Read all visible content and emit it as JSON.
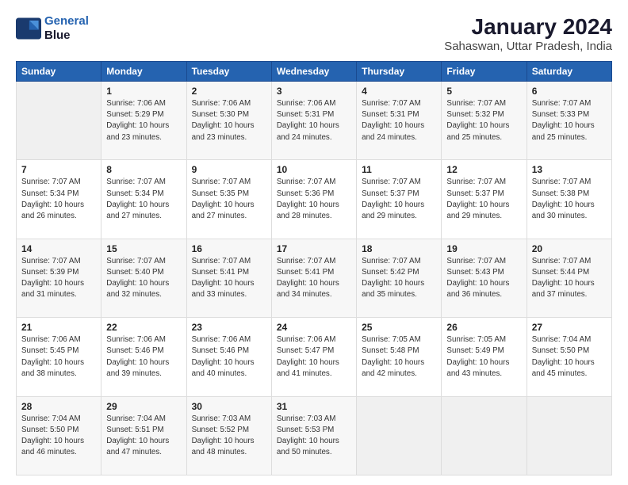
{
  "logo": {
    "line1": "General",
    "line2": "Blue"
  },
  "title": "January 2024",
  "subtitle": "Sahaswan, Uttar Pradesh, India",
  "weekdays": [
    "Sunday",
    "Monday",
    "Tuesday",
    "Wednesday",
    "Thursday",
    "Friday",
    "Saturday"
  ],
  "weeks": [
    [
      {
        "day": "",
        "empty": true
      },
      {
        "day": "1",
        "sunrise": "7:06 AM",
        "sunset": "5:29 PM",
        "daylight": "10 hours and 23 minutes."
      },
      {
        "day": "2",
        "sunrise": "7:06 AM",
        "sunset": "5:30 PM",
        "daylight": "10 hours and 23 minutes."
      },
      {
        "day": "3",
        "sunrise": "7:06 AM",
        "sunset": "5:31 PM",
        "daylight": "10 hours and 24 minutes."
      },
      {
        "day": "4",
        "sunrise": "7:07 AM",
        "sunset": "5:31 PM",
        "daylight": "10 hours and 24 minutes."
      },
      {
        "day": "5",
        "sunrise": "7:07 AM",
        "sunset": "5:32 PM",
        "daylight": "10 hours and 25 minutes."
      },
      {
        "day": "6",
        "sunrise": "7:07 AM",
        "sunset": "5:33 PM",
        "daylight": "10 hours and 25 minutes."
      }
    ],
    [
      {
        "day": "7",
        "sunrise": "7:07 AM",
        "sunset": "5:34 PM",
        "daylight": "10 hours and 26 minutes."
      },
      {
        "day": "8",
        "sunrise": "7:07 AM",
        "sunset": "5:34 PM",
        "daylight": "10 hours and 27 minutes."
      },
      {
        "day": "9",
        "sunrise": "7:07 AM",
        "sunset": "5:35 PM",
        "daylight": "10 hours and 27 minutes."
      },
      {
        "day": "10",
        "sunrise": "7:07 AM",
        "sunset": "5:36 PM",
        "daylight": "10 hours and 28 minutes."
      },
      {
        "day": "11",
        "sunrise": "7:07 AM",
        "sunset": "5:37 PM",
        "daylight": "10 hours and 29 minutes."
      },
      {
        "day": "12",
        "sunrise": "7:07 AM",
        "sunset": "5:37 PM",
        "daylight": "10 hours and 29 minutes."
      },
      {
        "day": "13",
        "sunrise": "7:07 AM",
        "sunset": "5:38 PM",
        "daylight": "10 hours and 30 minutes."
      }
    ],
    [
      {
        "day": "14",
        "sunrise": "7:07 AM",
        "sunset": "5:39 PM",
        "daylight": "10 hours and 31 minutes."
      },
      {
        "day": "15",
        "sunrise": "7:07 AM",
        "sunset": "5:40 PM",
        "daylight": "10 hours and 32 minutes."
      },
      {
        "day": "16",
        "sunrise": "7:07 AM",
        "sunset": "5:41 PM",
        "daylight": "10 hours and 33 minutes."
      },
      {
        "day": "17",
        "sunrise": "7:07 AM",
        "sunset": "5:41 PM",
        "daylight": "10 hours and 34 minutes."
      },
      {
        "day": "18",
        "sunrise": "7:07 AM",
        "sunset": "5:42 PM",
        "daylight": "10 hours and 35 minutes."
      },
      {
        "day": "19",
        "sunrise": "7:07 AM",
        "sunset": "5:43 PM",
        "daylight": "10 hours and 36 minutes."
      },
      {
        "day": "20",
        "sunrise": "7:07 AM",
        "sunset": "5:44 PM",
        "daylight": "10 hours and 37 minutes."
      }
    ],
    [
      {
        "day": "21",
        "sunrise": "7:06 AM",
        "sunset": "5:45 PM",
        "daylight": "10 hours and 38 minutes."
      },
      {
        "day": "22",
        "sunrise": "7:06 AM",
        "sunset": "5:46 PM",
        "daylight": "10 hours and 39 minutes."
      },
      {
        "day": "23",
        "sunrise": "7:06 AM",
        "sunset": "5:46 PM",
        "daylight": "10 hours and 40 minutes."
      },
      {
        "day": "24",
        "sunrise": "7:06 AM",
        "sunset": "5:47 PM",
        "daylight": "10 hours and 41 minutes."
      },
      {
        "day": "25",
        "sunrise": "7:05 AM",
        "sunset": "5:48 PM",
        "daylight": "10 hours and 42 minutes."
      },
      {
        "day": "26",
        "sunrise": "7:05 AM",
        "sunset": "5:49 PM",
        "daylight": "10 hours and 43 minutes."
      },
      {
        "day": "27",
        "sunrise": "7:04 AM",
        "sunset": "5:50 PM",
        "daylight": "10 hours and 45 minutes."
      }
    ],
    [
      {
        "day": "28",
        "sunrise": "7:04 AM",
        "sunset": "5:50 PM",
        "daylight": "10 hours and 46 minutes."
      },
      {
        "day": "29",
        "sunrise": "7:04 AM",
        "sunset": "5:51 PM",
        "daylight": "10 hours and 47 minutes."
      },
      {
        "day": "30",
        "sunrise": "7:03 AM",
        "sunset": "5:52 PM",
        "daylight": "10 hours and 48 minutes."
      },
      {
        "day": "31",
        "sunrise": "7:03 AM",
        "sunset": "5:53 PM",
        "daylight": "10 hours and 50 minutes."
      },
      {
        "day": "",
        "empty": true
      },
      {
        "day": "",
        "empty": true
      },
      {
        "day": "",
        "empty": true
      }
    ]
  ]
}
